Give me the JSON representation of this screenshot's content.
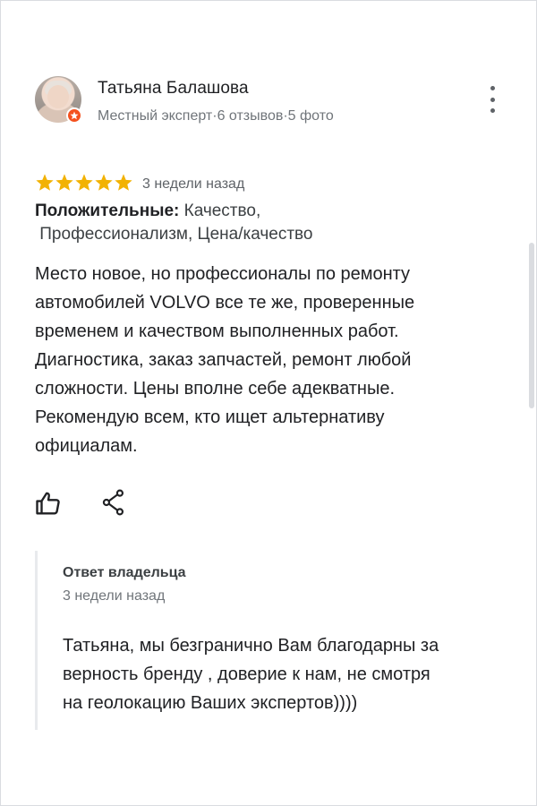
{
  "review": {
    "author_name": "Татьяна Балашова",
    "author_meta": "Местный эксперт·6 отзывов·5 фото",
    "rating": 5,
    "rating_max": 5,
    "date": "3 недели назад",
    "positives_label": "Положительные:",
    "positives_value": " Качество,\n Профессионализм, Цена/качество",
    "text": "Место новое, но профессионалы по ремонту\nавтомобилей VOLVO все те же, проверенные\nвременем и качеством выполненных работ.\nДиагностика, заказ запчастей, ремонт любой\nсложности. Цены вполне себе адекватные.\nРекомендую всем, кто ищет альтернативу\nофициалам."
  },
  "owner_reply": {
    "title": "Ответ владельца",
    "date": "3 недели назад",
    "text": "Татьяна, мы безгранично Вам благодарны за\nверность бренду , доверие к нам, не смотря\nна геолокацию Ваших экспертов))))"
  },
  "icons": {
    "more": "more-vert-icon",
    "star": "star-icon",
    "like": "thumb-up-icon",
    "share": "share-icon",
    "badge": "local-guide-badge-icon"
  },
  "colors": {
    "star": "#f2b203",
    "badge": "#f4511e",
    "text": "#202124",
    "secondary": "#70757a"
  }
}
